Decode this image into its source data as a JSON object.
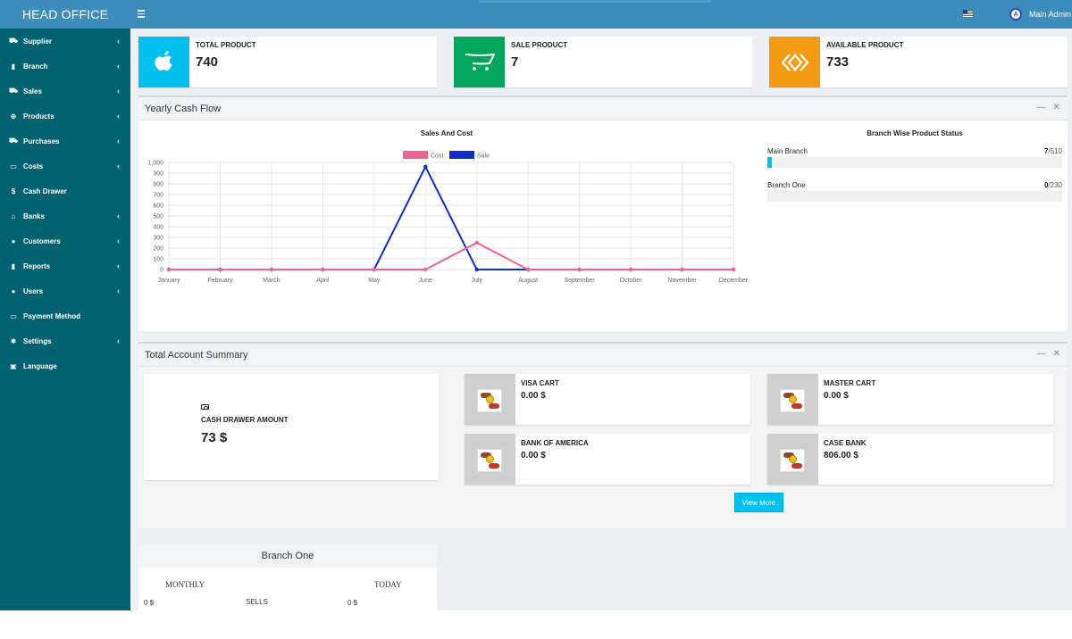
{
  "app": {
    "title": "HEAD OFFICE"
  },
  "topbar": {
    "user_name": "Main Admin",
    "avatar_initial": "A",
    "flag_icon": "us-flag-icon"
  },
  "sidebar": {
    "items": [
      {
        "label": "Supplier",
        "icon": "cart-icon",
        "has_children": true
      },
      {
        "label": "Branch",
        "icon": "file-icon",
        "has_children": true
      },
      {
        "label": "Sales",
        "icon": "cart-icon",
        "has_children": true
      },
      {
        "label": "Products",
        "icon": "globe-icon",
        "has_children": true
      },
      {
        "label": "Purchases",
        "icon": "cart-icon",
        "has_children": true
      },
      {
        "label": "Costs",
        "icon": "money-icon",
        "has_children": true
      },
      {
        "label": "Cash Drawer",
        "icon": "dollar-icon",
        "has_children": false
      },
      {
        "label": "Banks",
        "icon": "bank-icon",
        "has_children": true
      },
      {
        "label": "Customers",
        "icon": "user-icon",
        "has_children": true
      },
      {
        "label": "Reports",
        "icon": "file-icon",
        "has_children": true
      },
      {
        "label": "Users",
        "icon": "users-icon",
        "has_children": true
      },
      {
        "label": "Payment Method",
        "icon": "money-icon",
        "has_children": false
      },
      {
        "label": "Settings",
        "icon": "gear-icon",
        "has_children": true
      },
      {
        "label": "Language",
        "icon": "language-icon",
        "has_children": false
      }
    ]
  },
  "stats": [
    {
      "label": "TOTAL PRODUCT",
      "value": "740",
      "color": "#00c0ef",
      "icon": "apple-icon"
    },
    {
      "label": "SALE PRODUCT",
      "value": "7",
      "color": "#00a65a",
      "icon": "opencart-icon"
    },
    {
      "label": "AVAILABLE PRODUCT",
      "value": "733",
      "color": "#f39c12",
      "icon": "diamond-link-icon"
    }
  ],
  "cashflow": {
    "title": "Yearly Cash Flow",
    "branch_status": {
      "title": "Branch Wise Product Status",
      "rows": [
        {
          "name": "Main Branch",
          "sold": "7",
          "total": "/510",
          "fraction": 0.0137
        },
        {
          "name": "Branch One",
          "sold": "0",
          "total": "/230",
          "fraction": 0
        }
      ]
    }
  },
  "chart_data": {
    "type": "line",
    "title": "Sales And Cost",
    "categories": [
      "January",
      "February",
      "March",
      "April",
      "May",
      "June",
      "July",
      "August",
      "September",
      "October",
      "November",
      "December"
    ],
    "series": [
      {
        "name": "Cost",
        "color": "#f06292",
        "values": [
          0,
          0,
          0,
          0,
          0,
          0,
          250,
          0,
          0,
          0,
          0,
          0
        ]
      },
      {
        "name": "Sale",
        "color": "#0d2ec9",
        "values": [
          0,
          0,
          0,
          0,
          0,
          960,
          0,
          0,
          0,
          0,
          0,
          0
        ]
      }
    ],
    "yticks": [
      "0",
      "100",
      "200",
      "300",
      "400",
      "500",
      "600",
      "700",
      "800",
      "900",
      "1,000"
    ],
    "ylim": [
      0,
      1000
    ],
    "legend": "top",
    "grid": true
  },
  "summary": {
    "title": "Total Account Summary",
    "cash_drawer": {
      "label": "CASH DRAWER AMOUNT",
      "value": "73 $"
    },
    "accounts": [
      {
        "label": "VISA CART",
        "value": "0.00 $"
      },
      {
        "label": "MASTER CART",
        "value": "0.00 $"
      },
      {
        "label": "BANK OF AMERICA",
        "value": "0.00 $"
      },
      {
        "label": "CASE BANK",
        "value": "806.00 $"
      }
    ],
    "view_more": "View More"
  },
  "branch_card": {
    "title": "Branch One",
    "monthly_label": "MONTHLY",
    "today_label": "TODAY",
    "monthly_value": "0 $",
    "sells_label": "SELLS",
    "today_value": "0 $"
  }
}
